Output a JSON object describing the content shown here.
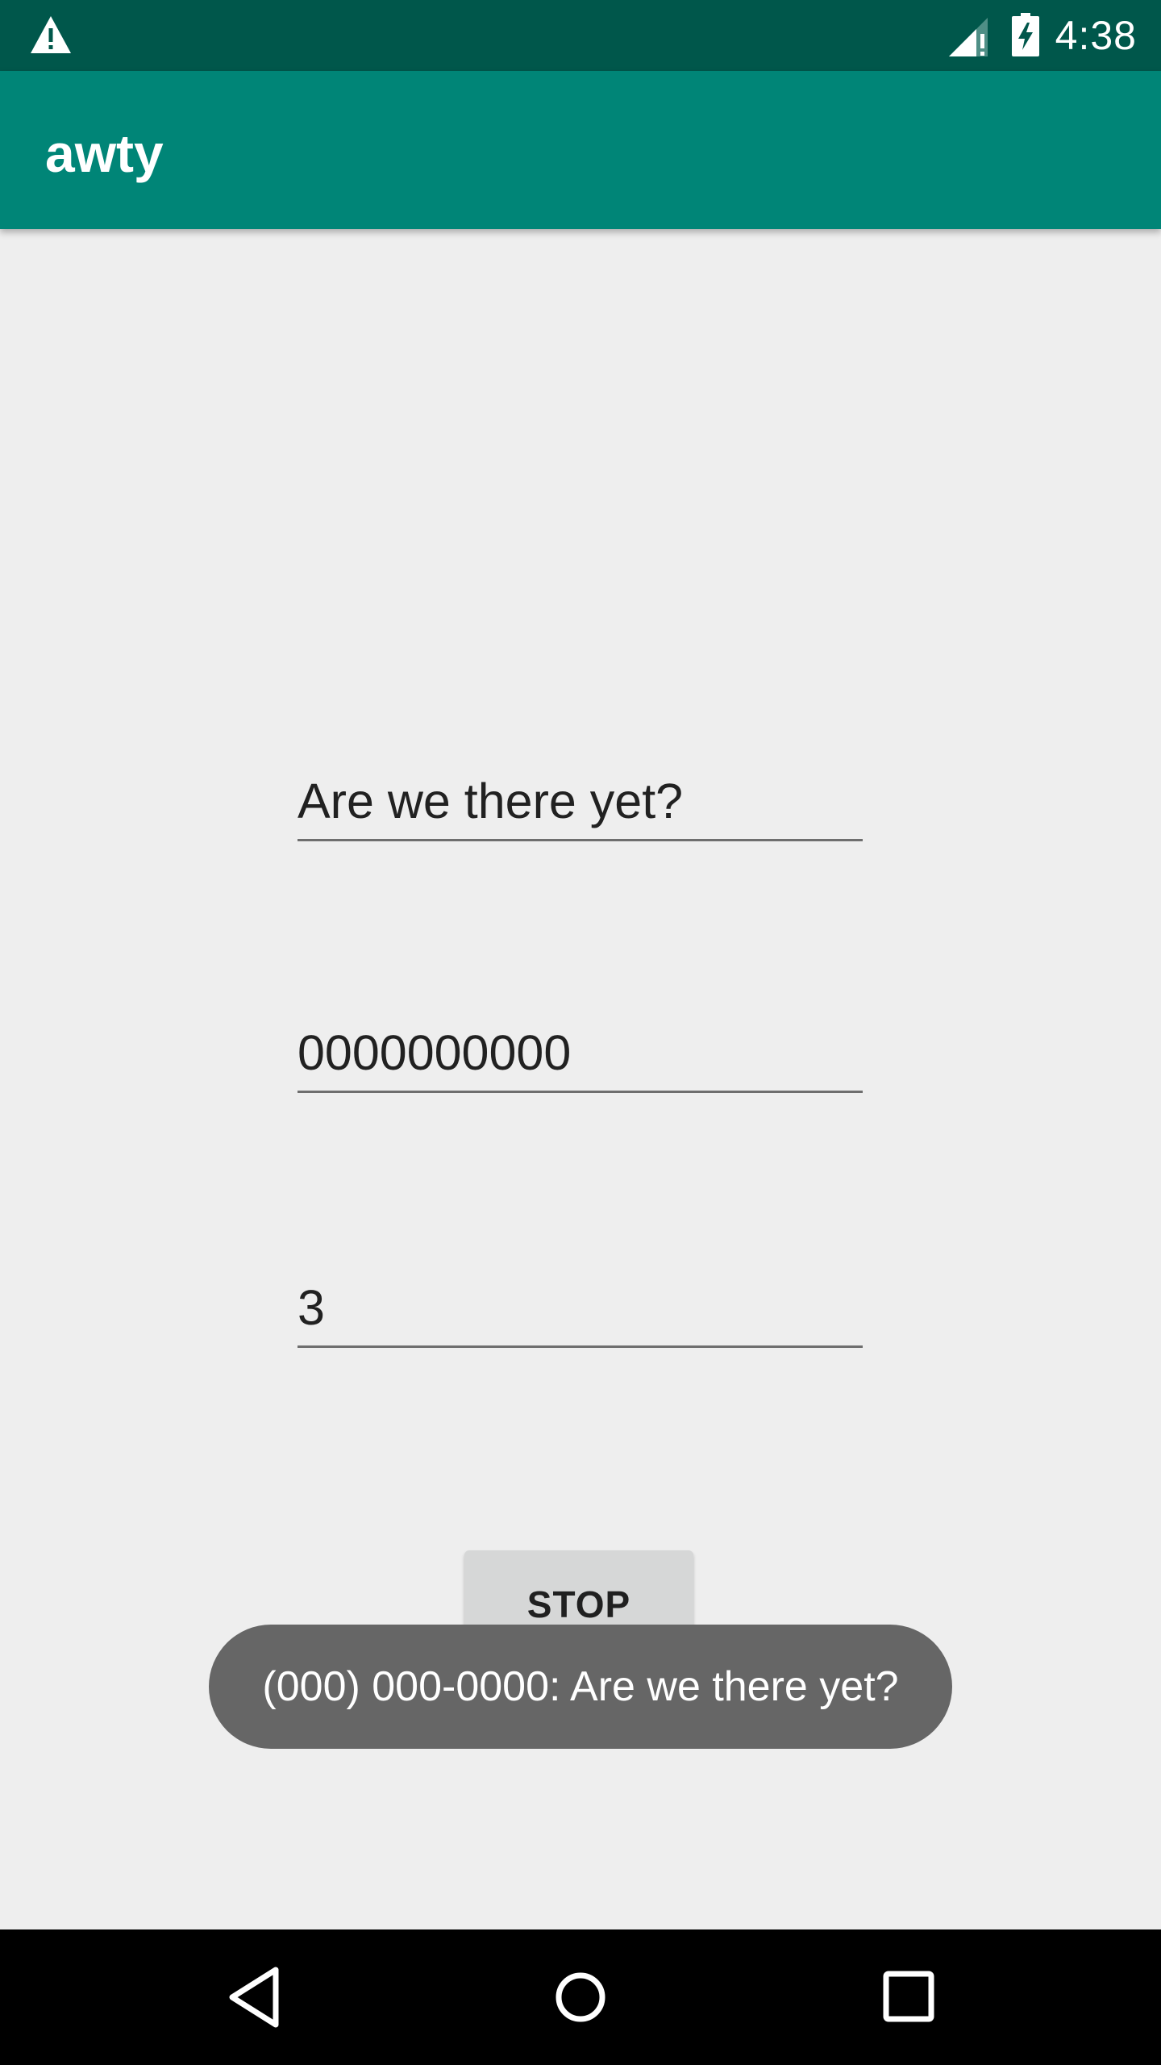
{
  "status_bar": {
    "time": "4:38",
    "icons": [
      "warning-icon",
      "signal-icon",
      "battery-charging-icon"
    ]
  },
  "app_bar": {
    "title": "awty"
  },
  "form": {
    "message_value": "Are we there yet?",
    "phone_value": "0000000000",
    "minutes_value": "3",
    "stop_label": "STOP"
  },
  "toast": {
    "text": "(000) 000-0000: Are we there yet?"
  },
  "nav_bar": {
    "icons": [
      "back-icon",
      "home-icon",
      "recents-icon"
    ]
  },
  "colors": {
    "status_bar": "#00574B",
    "app_bar": "#008577",
    "background": "#EEEEEE",
    "toast": "#666666",
    "button": "#D6D7D7"
  }
}
